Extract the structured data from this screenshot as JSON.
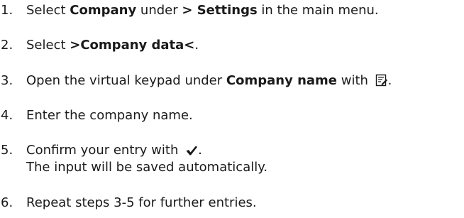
{
  "steps": [
    {
      "number": "1.",
      "parts": {
        "a": "Select ",
        "b": "Company",
        "c": " under ",
        "d": " > Settings",
        "e": " in the main menu."
      }
    },
    {
      "number": "2.",
      "parts": {
        "a": "Select ",
        "b": ">Company data<",
        "c": "."
      }
    },
    {
      "number": "3.",
      "parts": {
        "a": "Open the virtual keypad under ",
        "b": "Company name",
        "c": " with ",
        "icon": "edit-icon",
        "d": "."
      }
    },
    {
      "number": "4.",
      "parts": {
        "a": "Enter the company name."
      }
    },
    {
      "number": "5.",
      "parts": {
        "a": "Confirm your entry with ",
        "icon": "checkmark-icon",
        "b": ".",
        "line2": "The input will be saved automatically."
      }
    },
    {
      "number": "6.",
      "parts": {
        "a": "Repeat steps 3-5 for further entries."
      }
    }
  ]
}
